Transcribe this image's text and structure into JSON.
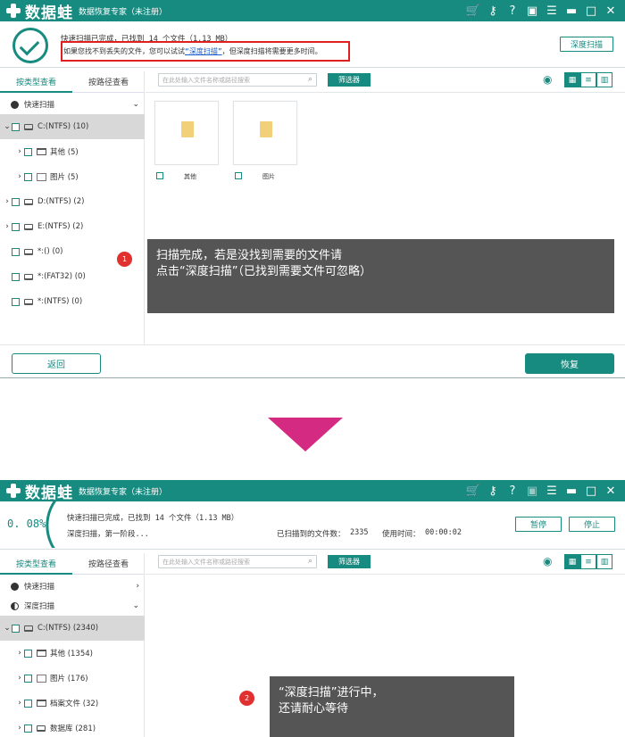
{
  "brand": {
    "logo_text": "数据蛙",
    "app_title": "数据恢复专家（未注册）",
    "accent": "#178b80",
    "arrow_color": "#d42a82",
    "badge_color": "#e0302f",
    "titlebar_icons": [
      "cart-icon",
      "key-icon",
      "help-icon",
      "save-icon",
      "menu-icon",
      "minimize-icon",
      "maximize-icon",
      "close-icon"
    ]
  },
  "window1": {
    "status": {
      "line1": "快速扫描已完成，已找到 14 个文件（1.13 MB）",
      "hint_prefix": "如果您找不到丢失的文件，您可以试试",
      "hint_link": "“深度扫描”",
      "hint_suffix": "，但深度扫描将需要更多时间。"
    },
    "deep_scan_button": "深度扫描",
    "tabs": {
      "by_type": "按类型查看",
      "by_path": "按路径查看"
    },
    "quick_scan": "快速扫描",
    "tree": [
      {
        "label": "C:(NTFS) (10)",
        "selected": true
      },
      {
        "label": "其他 (5)"
      },
      {
        "label": "图片 (5)"
      },
      {
        "label": "D:(NTFS) (2)"
      },
      {
        "label": "E:(NTFS) (2)"
      },
      {
        "label": "*:() (0)"
      },
      {
        "label": "*:(FAT32) (0)"
      },
      {
        "label": "*:(NTFS) (0)"
      }
    ],
    "search_placeholder": "在此处输入文件名称或路径搜索",
    "filter_button": "筛选器",
    "tiles": [
      {
        "label": "其他"
      },
      {
        "label": "图片"
      }
    ],
    "callout_text": "扫描完成，若是没找到需要的文件请\n点击“深度扫描”（已找到需要文件可忽略）",
    "back_button": "返回",
    "recover_button": "恢复"
  },
  "window2": {
    "progress_text": "0. 08%",
    "progress": 0.08,
    "status_line1": "快速扫描已完成，已找到 14 个文件（1.13 MB）",
    "status_line2": "深度扫描，第一阶段...",
    "found_label": "已扫描到的文件数：",
    "found_count": "2335",
    "time_label": "使用时间：",
    "time_value": "00:00:02",
    "pause_button": "暂停",
    "stop_button": "停止",
    "tabs": {
      "by_type": "按类型查看",
      "by_path": "按路径查看"
    },
    "quick_scan": "快速扫描",
    "deep_scan": "深度扫描",
    "tree": [
      {
        "label": "C:(NTFS) (2340)",
        "selected": true
      },
      {
        "label": "其他 (1354)"
      },
      {
        "label": "图片 (176)"
      },
      {
        "label": "档案文件 (32)"
      },
      {
        "label": "数据库 (281)"
      }
    ],
    "search_placeholder": "在此处输入文件名称或路径搜索",
    "filter_button": "筛选器",
    "callout_text": "“深度扫描”进行中，\n还请耐心等待"
  }
}
